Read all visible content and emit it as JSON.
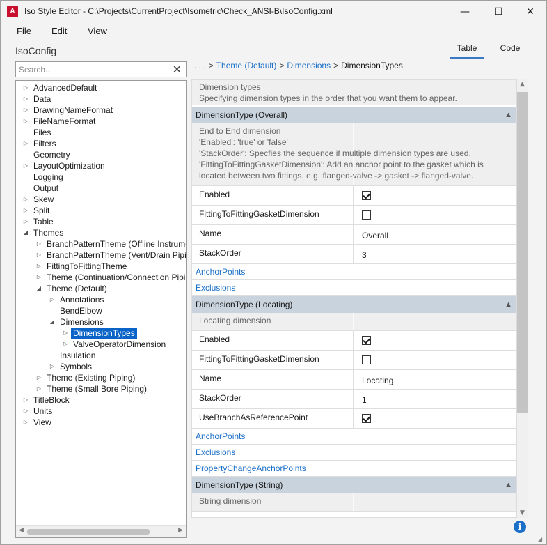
{
  "window": {
    "app_icon": "A",
    "title": "Iso Style Editor - C:\\Projects\\CurrentProject\\Isometric\\Check_ANSI-B\\IsoConfig.xml",
    "min_glyph": "—",
    "max_glyph": "☐",
    "close_glyph": "✕"
  },
  "menu": {
    "file": "File",
    "edit": "Edit",
    "view": "View"
  },
  "config_label": "IsoConfig",
  "view_tabs": {
    "table": "Table",
    "code": "Code",
    "active": "Table"
  },
  "search": {
    "placeholder": "Search...",
    "clear_glyph": "✕"
  },
  "tree": {
    "items": [
      {
        "label": "AdvancedDefault",
        "level": 0,
        "arrow": "▷"
      },
      {
        "label": "Data",
        "level": 0,
        "arrow": "▷"
      },
      {
        "label": "DrawingNameFormat",
        "level": 0,
        "arrow": "▷"
      },
      {
        "label": "FileNameFormat",
        "level": 0,
        "arrow": "▷"
      },
      {
        "label": "Files",
        "level": 0,
        "arrow": ""
      },
      {
        "label": "Filters",
        "level": 0,
        "arrow": "▷"
      },
      {
        "label": "Geometry",
        "level": 0,
        "arrow": ""
      },
      {
        "label": "LayoutOptimization",
        "level": 0,
        "arrow": "▷"
      },
      {
        "label": "Logging",
        "level": 0,
        "arrow": ""
      },
      {
        "label": "Output",
        "level": 0,
        "arrow": ""
      },
      {
        "label": "Skew",
        "level": 0,
        "arrow": "▷"
      },
      {
        "label": "Split",
        "level": 0,
        "arrow": "▷"
      },
      {
        "label": "Table",
        "level": 0,
        "arrow": "▷"
      },
      {
        "label": "Themes",
        "level": 0,
        "arrow": "◢"
      },
      {
        "label": "BranchPatternTheme (Offline Instruments)",
        "level": 1,
        "arrow": "▷"
      },
      {
        "label": "BranchPatternTheme (Vent/Drain Piping)",
        "level": 1,
        "arrow": "▷"
      },
      {
        "label": "FittingToFittingTheme",
        "level": 1,
        "arrow": "▷"
      },
      {
        "label": "Theme (Continuation/Connection Piping)",
        "level": 1,
        "arrow": "▷"
      },
      {
        "label": "Theme (Default)",
        "level": 1,
        "arrow": "◢"
      },
      {
        "label": "Annotations",
        "level": 2,
        "arrow": "▷"
      },
      {
        "label": "BendElbow",
        "level": 2,
        "arrow": ""
      },
      {
        "label": "Dimensions",
        "level": 2,
        "arrow": "◢"
      },
      {
        "label": "DimensionTypes",
        "level": 3,
        "arrow": "▷",
        "selected": true
      },
      {
        "label": "ValveOperatorDimension",
        "level": 3,
        "arrow": "▷"
      },
      {
        "label": "Insulation",
        "level": 2,
        "arrow": ""
      },
      {
        "label": "Symbols",
        "level": 2,
        "arrow": "▷"
      },
      {
        "label": "Theme (Existing Piping)",
        "level": 1,
        "arrow": "▷"
      },
      {
        "label": "Theme (Small Bore Piping)",
        "level": 1,
        "arrow": "▷"
      },
      {
        "label": "TitleBlock",
        "level": 0,
        "arrow": "▷"
      },
      {
        "label": "Units",
        "level": 0,
        "arrow": "▷"
      },
      {
        "label": "View",
        "level": 0,
        "arrow": "▷"
      }
    ]
  },
  "breadcrumb": {
    "ellipsis": ". . .",
    "sep": ">",
    "theme": "Theme (Default)",
    "dimensions": "Dimensions",
    "current": "DimensionTypes"
  },
  "grid": {
    "header_desc": {
      "title": "Dimension types",
      "text": "Specifying dimension types in the order that you want them to appear."
    },
    "sections": [
      {
        "title": "DimensionType (Overall)",
        "collapse_glyph": "▲",
        "desc": [
          "End to End dimension",
          "'Enabled': 'true' or 'false'",
          "'StackOrder': Specfies the sequence if multiple dimension types are used.",
          "'FittingToFittingGasketDimension': Add an anchor point to the gasket which is",
          "located between two fittings. e.g. flanged-valve -> gasket -> flanged-valve."
        ],
        "props": [
          {
            "name": "Enabled",
            "type": "checkbox",
            "checked": true
          },
          {
            "name": "FittingToFittingGasketDimension",
            "type": "checkbox",
            "checked": false
          },
          {
            "name": "Name",
            "type": "text",
            "value": "Overall"
          },
          {
            "name": "StackOrder",
            "type": "text",
            "value": "3"
          }
        ],
        "links": [
          "AnchorPoints",
          "Exclusions"
        ]
      },
      {
        "title": "DimensionType (Locating)",
        "collapse_glyph": "▲",
        "desc": [
          "Locating dimension"
        ],
        "props": [
          {
            "name": "Enabled",
            "type": "checkbox",
            "checked": true
          },
          {
            "name": "FittingToFittingGasketDimension",
            "type": "checkbox",
            "checked": false
          },
          {
            "name": "Name",
            "type": "text",
            "value": "Locating"
          },
          {
            "name": "StackOrder",
            "type": "text",
            "value": "1"
          },
          {
            "name": "UseBranchAsReferencePoint",
            "type": "checkbox",
            "checked": true
          }
        ],
        "links": [
          "AnchorPoints",
          "Exclusions",
          "PropertyChangeAnchorPoints"
        ]
      },
      {
        "title": "DimensionType (String)",
        "collapse_glyph": "▲",
        "desc": [
          "String dimension"
        ],
        "props": [],
        "links": []
      }
    ]
  },
  "scroll": {
    "up": "▲",
    "down": "▼",
    "left": "◀",
    "right": "▶"
  },
  "info_glyph": "i",
  "grip_glyph": "◢"
}
